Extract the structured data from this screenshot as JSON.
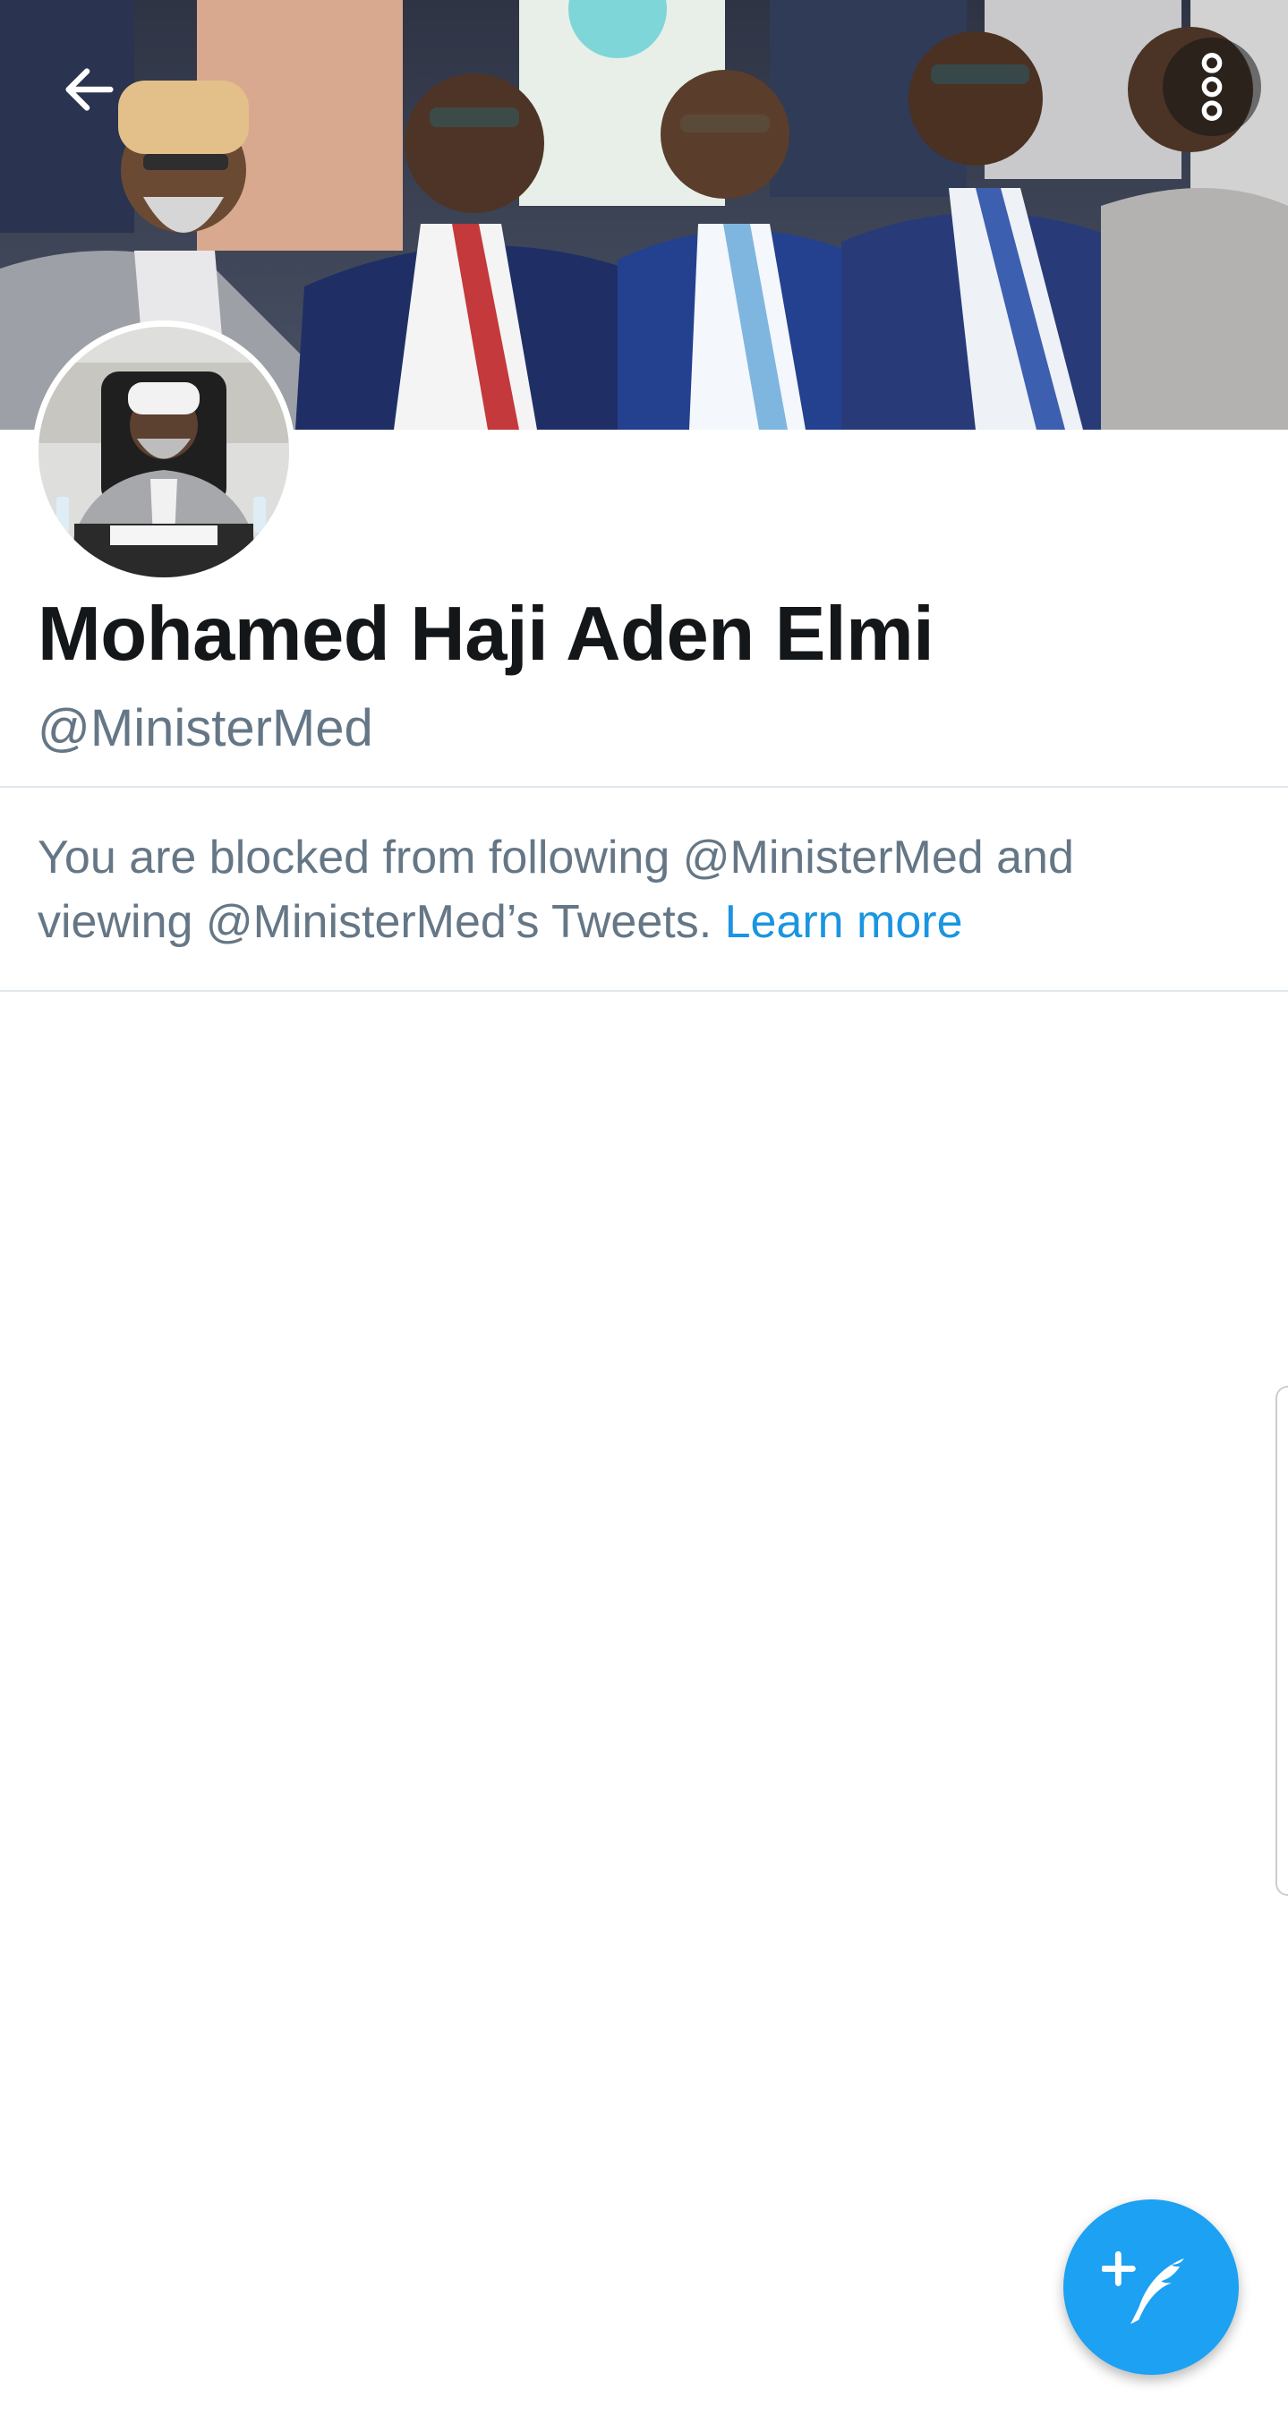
{
  "header": {
    "back_icon": "arrow-left-icon",
    "more_icon": "more-vertical-icon",
    "banner_image": "photo of seated officials in suits"
  },
  "profile": {
    "name": "Mohamed Haji Aden Elmi",
    "handle": "@MinisterMed"
  },
  "notice": {
    "text": "You are blocked from following @MinisterMed and viewing @MinisterMed’s Tweets. ",
    "link_label": "Learn more"
  },
  "fab": {
    "icon": "compose-tweet-icon"
  },
  "colors": {
    "accent": "#1da1f2",
    "link": "#1b95e0",
    "secondary_text": "#657786",
    "primary_text": "#14171a",
    "divider": "#e1e8ed"
  }
}
